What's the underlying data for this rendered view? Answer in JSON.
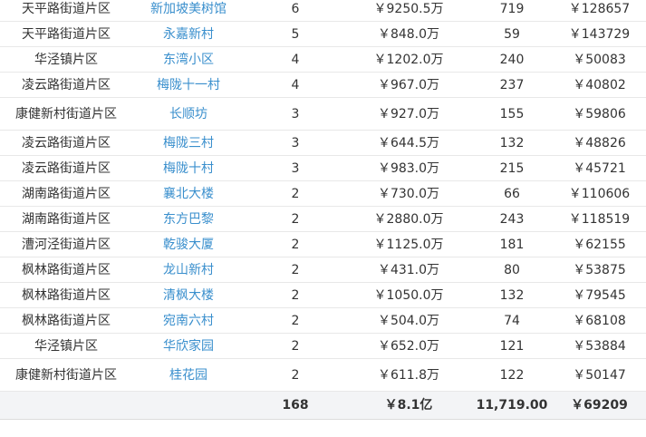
{
  "table": {
    "rows": [
      {
        "area": "天平路街道片区",
        "name": "新加坡美树馆",
        "count": "6",
        "total": "￥9250.5万",
        "size": "719",
        "unit_price": "￥128657"
      },
      {
        "area": "天平路街道片区",
        "name": "永嘉新村",
        "count": "5",
        "total": "￥848.0万",
        "size": "59",
        "unit_price": "￥143729"
      },
      {
        "area": "华泾镇片区",
        "name": "东湾小区",
        "count": "4",
        "total": "￥1202.0万",
        "size": "240",
        "unit_price": "￥50083"
      },
      {
        "area": "凌云路街道片区",
        "name": "梅陇十一村",
        "count": "4",
        "total": "￥967.0万",
        "size": "237",
        "unit_price": "￥40802"
      },
      {
        "area": "康健新村街道片区",
        "name": "长顺坊",
        "count": "3",
        "total": "￥927.0万",
        "size": "155",
        "unit_price": "￥59806"
      },
      {
        "area": "凌云路街道片区",
        "name": "梅陇三村",
        "count": "3",
        "total": "￥644.5万",
        "size": "132",
        "unit_price": "￥48826"
      },
      {
        "area": "凌云路街道片区",
        "name": "梅陇十村",
        "count": "3",
        "total": "￥983.0万",
        "size": "215",
        "unit_price": "￥45721"
      },
      {
        "area": "湖南路街道片区",
        "name": "襄北大楼",
        "count": "2",
        "total": "￥730.0万",
        "size": "66",
        "unit_price": "￥110606"
      },
      {
        "area": "湖南路街道片区",
        "name": "东方巴黎",
        "count": "2",
        "total": "￥2880.0万",
        "size": "243",
        "unit_price": "￥118519"
      },
      {
        "area": "漕河泾街道片区",
        "name": "乾骏大厦",
        "count": "2",
        "total": "￥1125.0万",
        "size": "181",
        "unit_price": "￥62155"
      },
      {
        "area": "枫林路街道片区",
        "name": "龙山新村",
        "count": "2",
        "total": "￥431.0万",
        "size": "80",
        "unit_price": "￥53875"
      },
      {
        "area": "枫林路街道片区",
        "name": "清枫大楼",
        "count": "2",
        "total": "￥1050.0万",
        "size": "132",
        "unit_price": "￥79545"
      },
      {
        "area": "枫林路街道片区",
        "name": "宛南六村",
        "count": "2",
        "total": "￥504.0万",
        "size": "74",
        "unit_price": "￥68108"
      },
      {
        "area": "华泾镇片区",
        "name": "华欣家园",
        "count": "2",
        "total": "￥652.0万",
        "size": "121",
        "unit_price": "￥53884"
      },
      {
        "area": "康健新村街道片区",
        "name": "桂花园",
        "count": "2",
        "total": "￥611.8万",
        "size": "122",
        "unit_price": "￥50147"
      }
    ],
    "summary": {
      "area": "",
      "name": "",
      "count": "168",
      "total": "￥8.1亿",
      "size": "11,719.00",
      "unit_price": "￥69209"
    }
  }
}
